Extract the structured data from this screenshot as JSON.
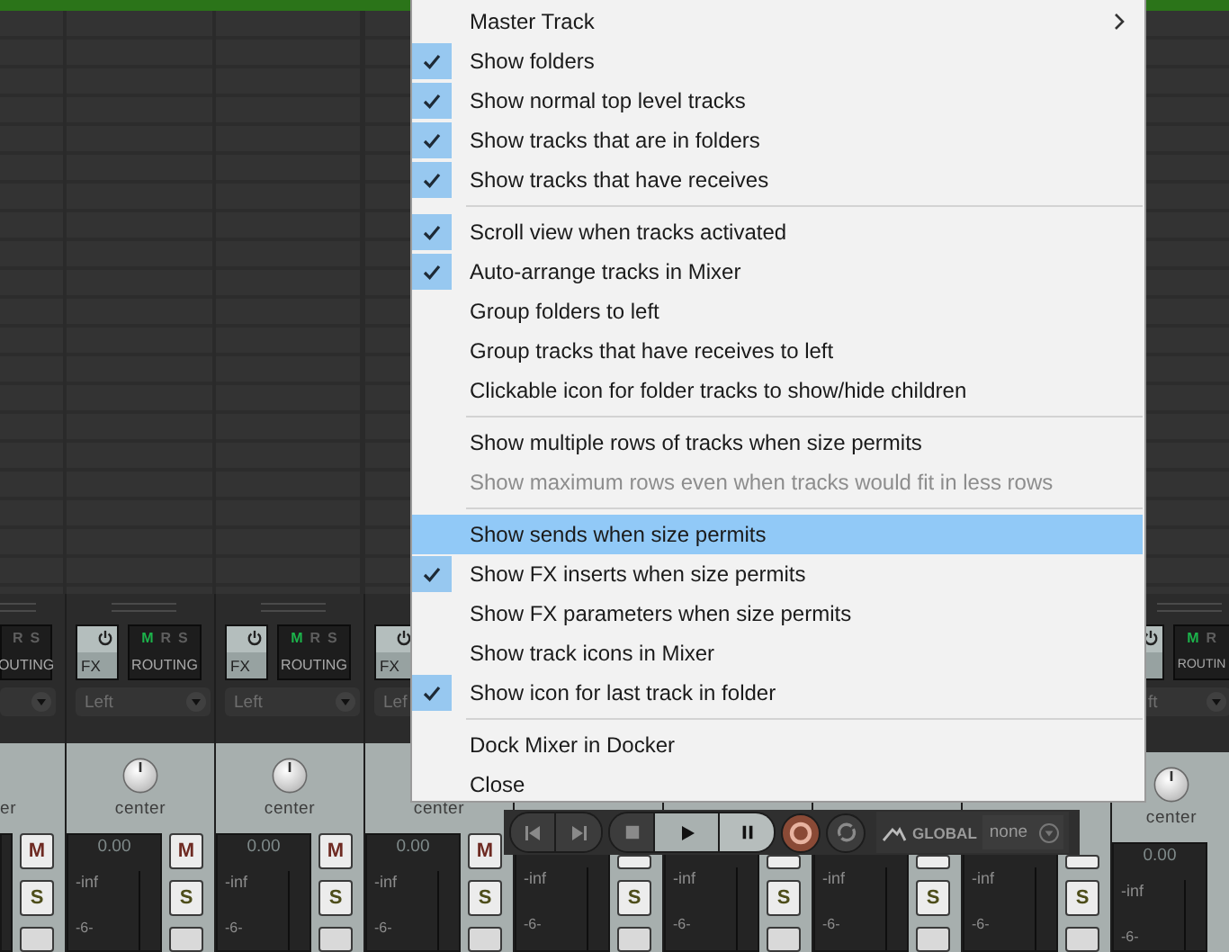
{
  "menu": {
    "items": [
      {
        "kind": "item",
        "label": "Master Track",
        "checked": false,
        "disabled": false,
        "selected": false,
        "submenu": true
      },
      {
        "kind": "item",
        "label": "Show folders",
        "checked": true,
        "disabled": false,
        "selected": false,
        "submenu": false
      },
      {
        "kind": "item",
        "label": "Show normal top level tracks",
        "checked": true,
        "disabled": false,
        "selected": false,
        "submenu": false
      },
      {
        "kind": "item",
        "label": "Show tracks that are in folders",
        "checked": true,
        "disabled": false,
        "selected": false,
        "submenu": false
      },
      {
        "kind": "item",
        "label": "Show tracks that have receives",
        "checked": true,
        "disabled": false,
        "selected": false,
        "submenu": false
      },
      {
        "kind": "separator"
      },
      {
        "kind": "item",
        "label": "Scroll view when tracks activated",
        "checked": true,
        "disabled": false,
        "selected": false,
        "submenu": false
      },
      {
        "kind": "item",
        "label": "Auto-arrange tracks in Mixer",
        "checked": true,
        "disabled": false,
        "selected": false,
        "submenu": false
      },
      {
        "kind": "item",
        "label": "Group folders to left",
        "checked": false,
        "disabled": false,
        "selected": false,
        "submenu": false
      },
      {
        "kind": "item",
        "label": "Group tracks that have receives to left",
        "checked": false,
        "disabled": false,
        "selected": false,
        "submenu": false
      },
      {
        "kind": "item",
        "label": "Clickable icon for folder tracks to show/hide children",
        "checked": false,
        "disabled": false,
        "selected": false,
        "submenu": false
      },
      {
        "kind": "separator"
      },
      {
        "kind": "item",
        "label": "Show multiple rows of tracks when size permits",
        "checked": false,
        "disabled": false,
        "selected": false,
        "submenu": false
      },
      {
        "kind": "item",
        "label": "Show maximum rows even when tracks would fit in less rows",
        "checked": false,
        "disabled": true,
        "selected": false,
        "submenu": false
      },
      {
        "kind": "separator"
      },
      {
        "kind": "item",
        "label": "Show sends when size permits",
        "checked": false,
        "disabled": false,
        "selected": true,
        "submenu": false
      },
      {
        "kind": "item",
        "label": "Show FX inserts when size permits",
        "checked": true,
        "disabled": false,
        "selected": false,
        "submenu": false
      },
      {
        "kind": "item",
        "label": "Show FX parameters when size permits",
        "checked": false,
        "disabled": false,
        "selected": false,
        "submenu": false
      },
      {
        "kind": "item",
        "label": "Show track icons in Mixer",
        "checked": false,
        "disabled": false,
        "selected": false,
        "submenu": false
      },
      {
        "kind": "item",
        "label": "Show icon for last track in folder",
        "checked": true,
        "disabled": false,
        "selected": false,
        "submenu": false
      },
      {
        "kind": "separator"
      },
      {
        "kind": "item",
        "label": "Dock Mixer in Docker",
        "checked": false,
        "disabled": false,
        "selected": false,
        "submenu": false
      },
      {
        "kind": "item",
        "label": "Close",
        "checked": false,
        "disabled": false,
        "selected": false,
        "submenu": false
      }
    ]
  },
  "mixer": {
    "strips": [
      {
        "kind": "left_edge",
        "routing_letters": [
          {
            "letter": "R",
            "lit": false
          },
          {
            "letter": "S",
            "lit": false
          }
        ],
        "routing": "OUTING",
        "pan": "er",
        "mute": "M",
        "solo": "S"
      },
      {
        "kind": "full",
        "fx": "FX",
        "routing_letters": [
          {
            "letter": "M",
            "lit": true
          },
          {
            "letter": "R",
            "lit": false
          },
          {
            "letter": "S",
            "lit": false
          }
        ],
        "routing": "ROUTING",
        "input": "Left",
        "pan": "center",
        "volume": "0.00",
        "peak": "-inf",
        "scale": "-6-",
        "mute": "M",
        "solo": "S"
      },
      {
        "kind": "full",
        "fx": "FX",
        "routing_letters": [
          {
            "letter": "M",
            "lit": true
          },
          {
            "letter": "R",
            "lit": false
          },
          {
            "letter": "S",
            "lit": false
          }
        ],
        "routing": "ROUTING",
        "input": "Left",
        "pan": "center",
        "volume": "0.00",
        "peak": "-inf",
        "scale": "-6-",
        "mute": "M",
        "solo": "S"
      },
      {
        "kind": "covered",
        "fx": "FX",
        "input": "Lef",
        "pan": "center",
        "volume": "0.00",
        "peak": "-inf",
        "scale": "-6-",
        "mute": "M",
        "solo": "S"
      },
      {
        "kind": "covered",
        "peak": "-inf",
        "scale": "-6-",
        "solo": "S"
      },
      {
        "kind": "covered",
        "peak": "-inf",
        "scale": "-6-",
        "solo": "S"
      },
      {
        "kind": "covered",
        "peak": "-inf",
        "scale": "-6-",
        "solo": "S"
      },
      {
        "kind": "covered",
        "peak": "-inf",
        "scale": "-6-",
        "solo": "S"
      },
      {
        "kind": "right_edge",
        "routing_letters": [
          {
            "letter": "M",
            "lit": true
          },
          {
            "letter": "R",
            "lit": false
          }
        ],
        "routing": "ROUTIN",
        "input": "ft",
        "pan": "center",
        "volume": "0.00",
        "peak": "-inf",
        "scale": "-6-"
      }
    ]
  },
  "transport": {
    "automation_mode": "GLOBAL",
    "automation_value": "none"
  }
}
